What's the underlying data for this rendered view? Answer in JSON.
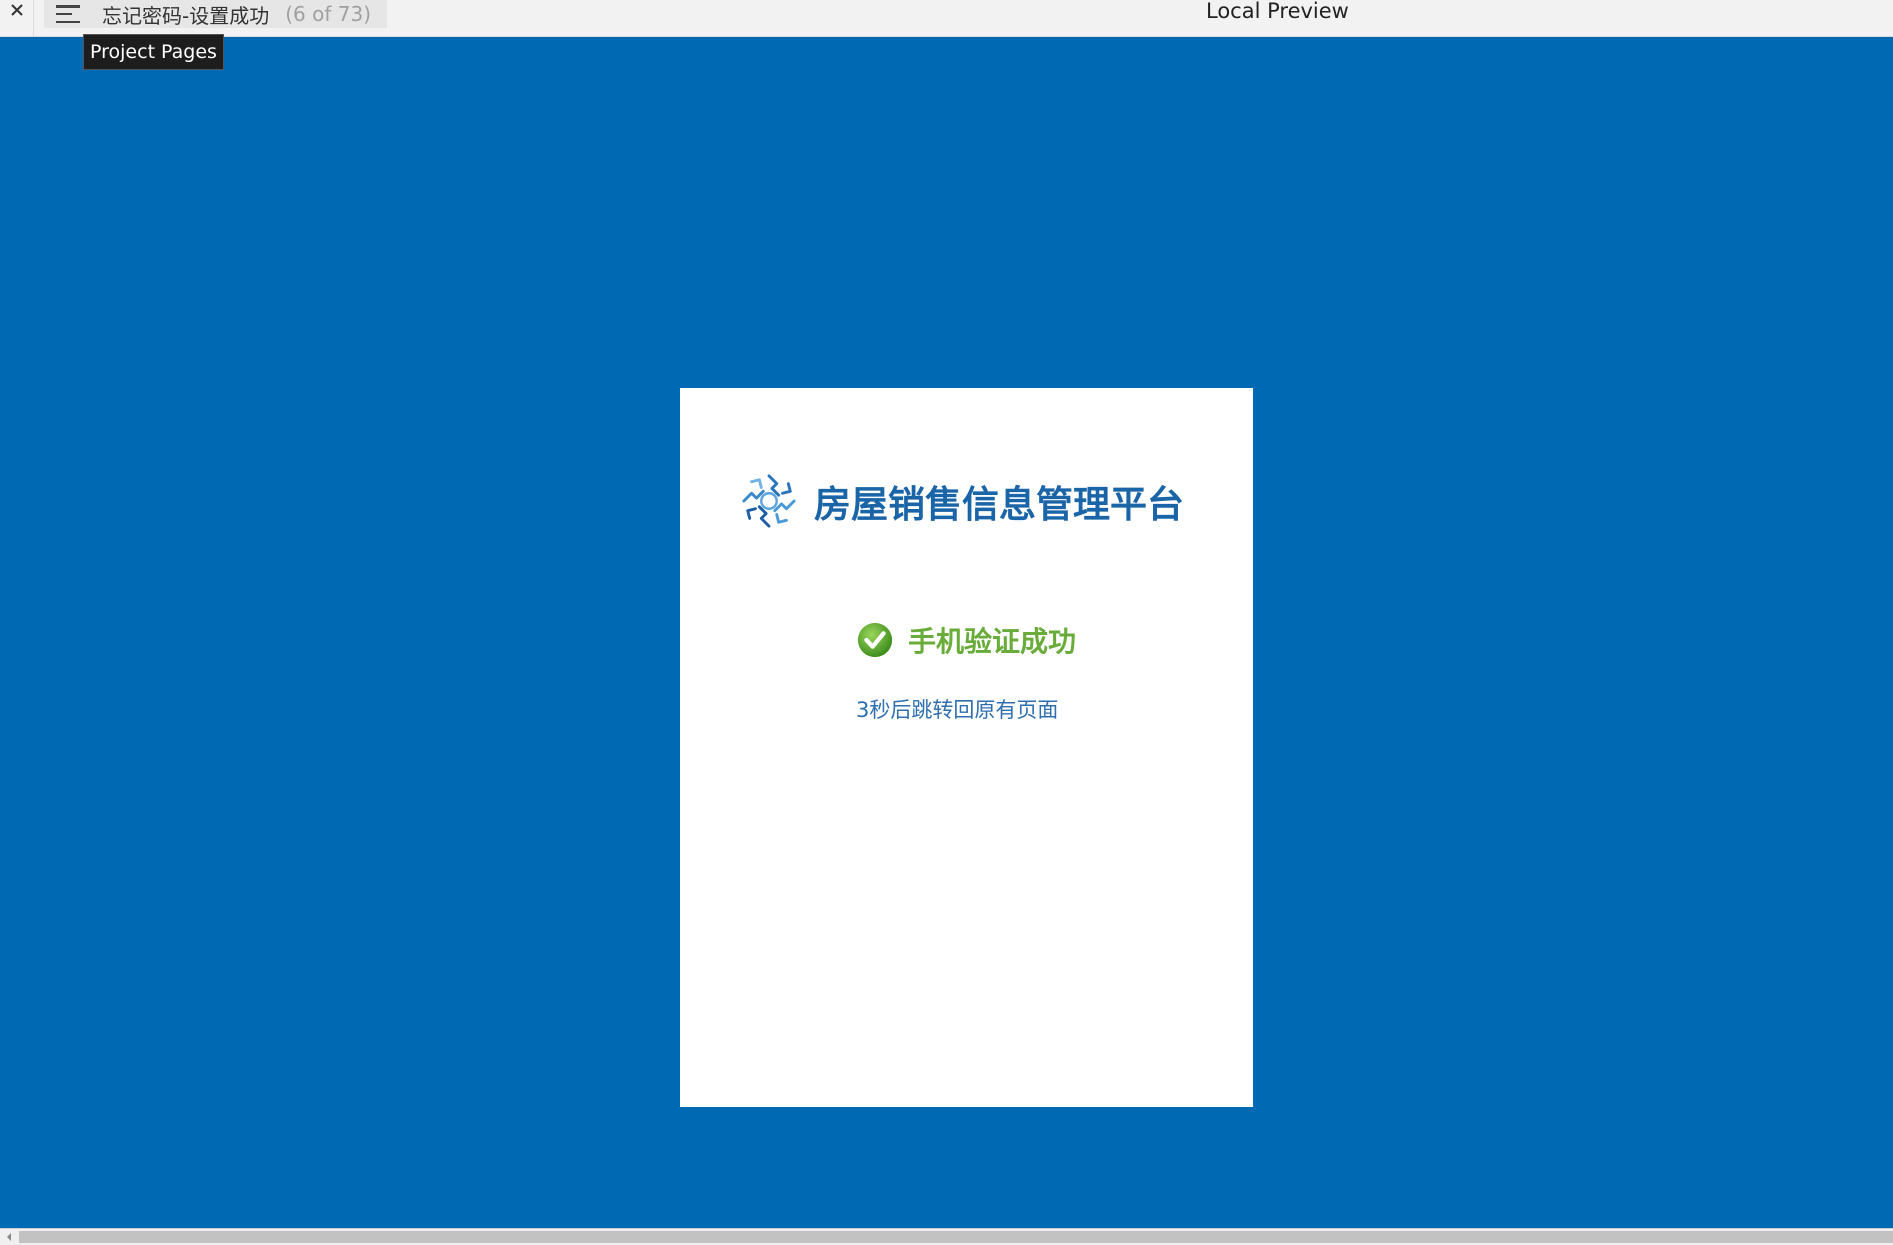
{
  "topbar": {
    "page_title": "忘记密码-设置成功",
    "page_count": "(6 of 73)",
    "preview_title": "Local Preview"
  },
  "tooltip": {
    "label": "Project Pages"
  },
  "card": {
    "brand_title": "房屋销售信息管理平台",
    "success_text": "手机验证成功",
    "redirect_text": "3秒后跳转回原有页面"
  },
  "icons": {
    "close": "close-icon",
    "menu": "hamburger-menu-icon",
    "logo": "brand-logo-icon",
    "check": "check-circle-icon",
    "scroll_left": "arrow-left-icon"
  },
  "colors": {
    "background": "#0069b4",
    "brand": "#1a64a8",
    "success": "#6aac3a",
    "link": "#2f6fb0"
  }
}
